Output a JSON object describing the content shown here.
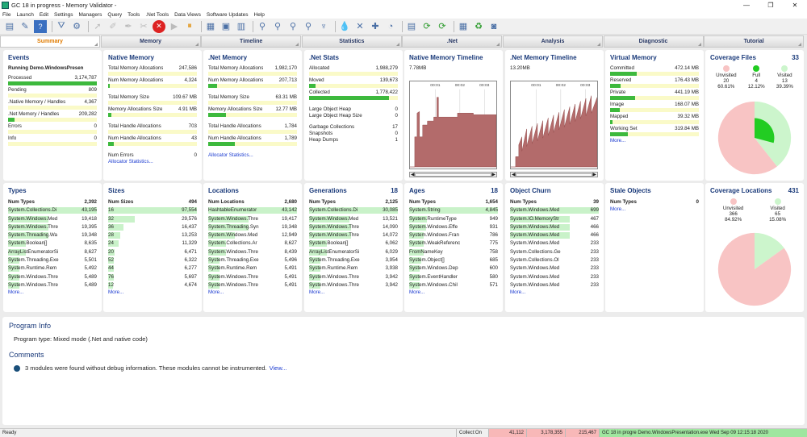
{
  "window": {
    "title": "GC 18 in progress - Memory Validator -",
    "controls": [
      "—",
      "❐",
      "✕"
    ]
  },
  "menu": [
    "File",
    "Launch",
    "Edit",
    "Settings",
    "Managers",
    "Query",
    "Tools",
    ".Net Tools",
    "Data Views",
    "Software Updates",
    "Help"
  ],
  "tabs": [
    "Summary",
    "Memory",
    "Timeline",
    "Statistics",
    ".Net",
    "Analysis",
    "Diagnostic",
    "Tutorial"
  ],
  "events": {
    "title": "Events",
    "running": "Running Demo.WindowsPresen",
    "rows": [
      {
        "label": "Processed",
        "value": "3,174,787",
        "frac": 1.0
      },
      {
        "label": "Pending",
        "value": "809",
        "frac": 0
      },
      {
        "label": ".Native Memory / Handles",
        "value": "4,367",
        "frac": 0
      },
      {
        "label": ".Net Memory / Handles",
        "value": "209,282",
        "frac": 0.07
      },
      {
        "label": "Errors",
        "value": "0",
        "frac": 0
      },
      {
        "label": "Info",
        "value": "0",
        "frac": 0
      }
    ]
  },
  "native": {
    "title": "Native Memory",
    "g1": [
      {
        "label": "Total Memory Allocations",
        "value": "247,586",
        "frac": 0
      },
      {
        "label": "Num Memory Allocations",
        "value": "4,324",
        "frac": 0.02
      }
    ],
    "g2": [
      {
        "label": "Total Memory Size",
        "value": "109.67 MB",
        "frac": 0
      },
      {
        "label": "Memory Allocations Size",
        "value": "4.91 MB",
        "frac": 0.04
      }
    ],
    "g3": [
      {
        "label": "Total Handle Allocations",
        "value": "703",
        "frac": 0
      },
      {
        "label": "Num Handle Allocations",
        "value": "43",
        "frac": 0.06
      }
    ],
    "errors_label": "Num Errors",
    "errors_value": "0",
    "link": "Allocator Statistics..."
  },
  "netmem": {
    "title": ".Net Memory",
    "g1": [
      {
        "label": "Total Memory Allocations",
        "value": "1,982,170",
        "frac": 0
      },
      {
        "label": "Num Memory Allocations",
        "value": "207,713",
        "frac": 0.1
      }
    ],
    "g2": [
      {
        "label": "Total Memory Size",
        "value": "63.31 MB",
        "frac": 0
      },
      {
        "label": "Memory Allocations Size",
        "value": "12.77 MB",
        "frac": 0.2
      }
    ],
    "g3": [
      {
        "label": "Total Handle Allocations",
        "value": "1,784",
        "frac": 0
      },
      {
        "label": "Num Handle Allocations",
        "value": "1,789",
        "frac": 0.3
      }
    ],
    "link": "Allocator Statistics..."
  },
  "netstats": {
    "title": ".Net Stats",
    "rows": [
      {
        "label": "Allocated",
        "value": "1,988,279",
        "frac": 0
      },
      {
        "label": "Moved",
        "value": "139,673",
        "frac": 0.07
      },
      {
        "label": "Collected",
        "value": "1,778,422",
        "frac": 0.9
      }
    ],
    "heap": [
      {
        "label": "Large Object Heap",
        "value": "0"
      },
      {
        "label": "Large Object Heap Size",
        "value": "0"
      }
    ],
    "gc": [
      {
        "label": "Garbage Collections",
        "value": "17"
      },
      {
        "label": "Snapshots",
        "value": "0"
      },
      {
        "label": "Heap Dumps",
        "value": "1"
      }
    ]
  },
  "nativeTimeline": {
    "title": "Native Memory Timeline",
    "peak": "7.78MB",
    "ticks": [
      "00:01",
      "00:02",
      "00:03"
    ]
  },
  "netTimeline": {
    "title": ".Net Memory Timeline",
    "peak": "13.20MB",
    "ticks": [
      "00:01",
      "00:02",
      "00:03"
    ]
  },
  "virtual": {
    "title": "Virtual Memory",
    "rows": [
      {
        "label": "Committed",
        "value": "472.14 MB",
        "frac": 0.3
      },
      {
        "label": "Reserved",
        "value": "176.43 MB",
        "frac": 0.12
      },
      {
        "label": "Private",
        "value": "441.19 MB",
        "frac": 0.28
      },
      {
        "label": "Image",
        "value": "168.07 MB",
        "frac": 0.11
      },
      {
        "label": "Mapped",
        "value": "39.32 MB",
        "frac": 0.03
      },
      {
        "label": "Working Set",
        "value": "319.84 MB",
        "frac": 0.2
      }
    ],
    "more": "More..."
  },
  "coverageFiles": {
    "title": "Coverage Files",
    "total": "33",
    "items": [
      {
        "label": "Unvisited",
        "count": "20",
        "pct": "60.61%",
        "color": "#f8c4c4"
      },
      {
        "label": "Full",
        "count": "4",
        "pct": "12.12%",
        "color": "#22cc22"
      },
      {
        "label": "Visited",
        "count": "13",
        "pct": "39.39%",
        "color": "#ccf5cc"
      }
    ]
  },
  "types": {
    "title": "Types",
    "count": "",
    "header": {
      "label": "Num Types",
      "value": "2,392"
    },
    "rows": [
      {
        "name": "System.Collections.Di",
        "value": "43,195",
        "frac": 1.0
      },
      {
        "name": "System.Windows.Med",
        "value": "19,418",
        "frac": 0.45
      },
      {
        "name": "System.Windows.Thre",
        "value": "19,395",
        "frac": 0.45
      },
      {
        "name": "System.Threading.Wa",
        "value": "19,348",
        "frac": 0.45
      },
      {
        "name": "System.Boolean[]",
        "value": "8,635",
        "frac": 0.2
      },
      {
        "name": "ArrayListEnumeratorSi",
        "value": "8,627",
        "frac": 0.2
      },
      {
        "name": "System.Threading.Exe",
        "value": "5,501",
        "frac": 0.13
      },
      {
        "name": "System.Runtime.Rem",
        "value": "5,492",
        "frac": 0.13
      },
      {
        "name": "System.Windows.Thre",
        "value": "5,489",
        "frac": 0.13
      },
      {
        "name": "System.Windows.Thre",
        "value": "5,489",
        "frac": 0.13
      }
    ],
    "more": "More..."
  },
  "sizes": {
    "title": "Sizes",
    "count": "",
    "header": {
      "label": "Num Sizes",
      "value": "494"
    },
    "rows": [
      {
        "name": "16",
        "value": "97,554",
        "frac": 1.0
      },
      {
        "name": "32",
        "value": "29,576",
        "frac": 0.3
      },
      {
        "name": "36",
        "value": "16,437",
        "frac": 0.17
      },
      {
        "name": "28",
        "value": "13,253",
        "frac": 0.14
      },
      {
        "name": "24",
        "value": "11,329",
        "frac": 0.12
      },
      {
        "name": "20",
        "value": "6,471",
        "frac": 0.07
      },
      {
        "name": "52",
        "value": "6,322",
        "frac": 0.06
      },
      {
        "name": "44",
        "value": "6,277",
        "frac": 0.06
      },
      {
        "name": "76",
        "value": "5,697",
        "frac": 0.06
      },
      {
        "name": "12",
        "value": "4,674",
        "frac": 0.05
      }
    ],
    "more": "More..."
  },
  "locations": {
    "title": "Locations",
    "count": "",
    "header": {
      "label": "Num Locations",
      "value": "2,680"
    },
    "rows": [
      {
        "name": "HashtableEnumerator",
        "value": "43,142",
        "frac": 1.0
      },
      {
        "name": "System.Windows.Thre",
        "value": "19,417",
        "frac": 0.45
      },
      {
        "name": "System.Threading.Syn",
        "value": "19,348",
        "frac": 0.45
      },
      {
        "name": "System.Windows.Med",
        "value": "12,949",
        "frac": 0.3
      },
      {
        "name": "System.Collections.Ar",
        "value": "8,627",
        "frac": 0.2
      },
      {
        "name": "System.Windows.Thre",
        "value": "8,439",
        "frac": 0.2
      },
      {
        "name": "System.Threading.Exe",
        "value": "5,496",
        "frac": 0.13
      },
      {
        "name": "System.Runtime.Rem",
        "value": "5,491",
        "frac": 0.13
      },
      {
        "name": "System.Windows.Thre",
        "value": "5,491",
        "frac": 0.13
      },
      {
        "name": "System.Windows.Thre",
        "value": "5,491",
        "frac": 0.13
      }
    ],
    "more": "More..."
  },
  "generations": {
    "title": "Generations",
    "count": "18",
    "header": {
      "label": "Num Types",
      "value": "2,125"
    },
    "rows": [
      {
        "name": "System.Collections.Di",
        "value": "30,085",
        "frac": 1.0
      },
      {
        "name": "System.Windows.Med",
        "value": "13,521",
        "frac": 0.45
      },
      {
        "name": "System.Windows.Thre",
        "value": "14,090",
        "frac": 0.47
      },
      {
        "name": "System.Windows.Thre",
        "value": "14,072",
        "frac": 0.47
      },
      {
        "name": "System.Boolean[]",
        "value": "6,062",
        "frac": 0.2
      },
      {
        "name": "ArrayListEnumeratorSi",
        "value": "6,029",
        "frac": 0.2
      },
      {
        "name": "System.Threading.Exe",
        "value": "3,954",
        "frac": 0.13
      },
      {
        "name": "System.Runtime.Rem",
        "value": "3,938",
        "frac": 0.13
      },
      {
        "name": "System.Windows.Thre",
        "value": "3,942",
        "frac": 0.13
      },
      {
        "name": "System.Windows.Thre",
        "value": "3,942",
        "frac": 0.13
      }
    ],
    "more": "More..."
  },
  "ages": {
    "title": "Ages",
    "count": "18",
    "header": {
      "label": "Num Types",
      "value": "1,654"
    },
    "rows": [
      {
        "name": "System.String",
        "value": "4,845",
        "frac": 1.0
      },
      {
        "name": "System.RuntimeType",
        "value": "949",
        "frac": 0.2
      },
      {
        "name": "System.Windows.Effe",
        "value": "931",
        "frac": 0.19
      },
      {
        "name": "System.Windows.Fran",
        "value": "786",
        "frac": 0.16
      },
      {
        "name": "System.WeakReferenc",
        "value": "775",
        "frac": 0.16
      },
      {
        "name": "FromNameKey",
        "value": "758",
        "frac": 0.16
      },
      {
        "name": "System.Object[]",
        "value": "685",
        "frac": 0.14
      },
      {
        "name": "System.Windows.Dep",
        "value": "600",
        "frac": 0.12
      },
      {
        "name": "System.EventHandler",
        "value": "580",
        "frac": 0.12
      },
      {
        "name": "System.Windows.Chil",
        "value": "571",
        "frac": 0.12
      }
    ],
    "more": "More..."
  },
  "churn": {
    "title": "Object Churn",
    "count": "",
    "header": {
      "label": "Num Types",
      "value": "39"
    },
    "rows": [
      {
        "name": "System.Windows.Med",
        "value": "699",
        "frac": 1.0
      },
      {
        "name": "System.IO.MemoryStr",
        "value": "467",
        "frac": 0.67
      },
      {
        "name": "System.Windows.Med",
        "value": "466",
        "frac": 0.67
      },
      {
        "name": "System.Windows.Med",
        "value": "466",
        "frac": 0.67
      },
      {
        "name": "System.Windows.Med",
        "value": "233",
        "frac": 0
      },
      {
        "name": "System.Collections.Ge",
        "value": "233",
        "frac": 0
      },
      {
        "name": "System.Collections.Ol",
        "value": "233",
        "frac": 0
      },
      {
        "name": "System.Windows.Med",
        "value": "233",
        "frac": 0
      },
      {
        "name": "System.Windows.Med",
        "value": "233",
        "frac": 0
      },
      {
        "name": "System.Windows.Med",
        "value": "233",
        "frac": 0
      }
    ],
    "more": "More..."
  },
  "stale": {
    "title": "Stale Objects",
    "header": {
      "label": "Num Types",
      "value": "0"
    },
    "more": "More..."
  },
  "coverageLoc": {
    "title": "Coverage Locations",
    "total": "431",
    "items": [
      {
        "label": "Unvisited",
        "count": "366",
        "pct": "84.92%",
        "color": "#f8c4c4"
      },
      {
        "label": "Visited",
        "count": "65",
        "pct": "15.08%",
        "color": "#ccf5cc"
      }
    ]
  },
  "programInfo": {
    "title": "Program Info",
    "text": "Program type: Mixed mode (.Net and native code)"
  },
  "comments": {
    "title": "Comments",
    "text": "3 modules were found without debug information. These modules cannot be instrumented.",
    "link": "View..."
  },
  "status": {
    "left": "Ready",
    "collect": "Collect:On",
    "v1": "41,112",
    "v2": "3,178,355",
    "v3": "215,467",
    "msg": "GC 18 in progre Demo.WindowsPresentation.exe Wed Sep 09 12:15:18 2020"
  },
  "colors": {
    "accent": "#e07b00",
    "bar": "#3db93d",
    "barbg": "#fafac8",
    "title": "#1a3a7a",
    "graph": "#b36b6b"
  }
}
